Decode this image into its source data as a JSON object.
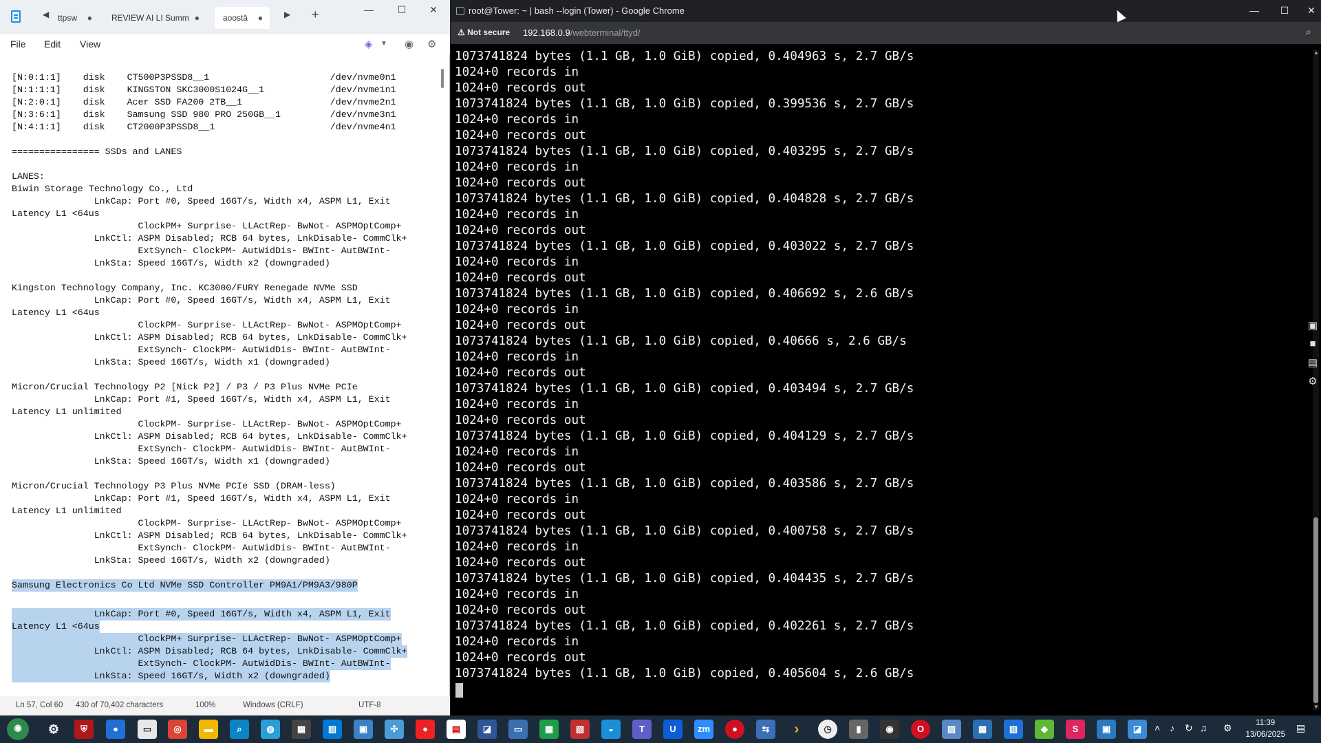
{
  "notepad": {
    "tabs": [
      {
        "label": "ttpsw",
        "active": false
      },
      {
        "label": "REVIEW AI LI",
        "active": false
      },
      {
        "label": "Summ",
        "active": false
      },
      {
        "label": "aoostâ",
        "active": true
      }
    ],
    "menu": [
      "File",
      "Edit",
      "View"
    ],
    "text_lines": [
      "[N:0:1:1]    disk    CT500P3PSSD8__1                      /dev/nvme0n1",
      "[N:1:1:1]    disk    KINGSTON SKC3000S1024G__1            /dev/nvme1n1",
      "[N:2:0:1]    disk    Acer SSD FA200 2TB__1                /dev/nvme2n1",
      "[N:3:6:1]    disk    Samsung SSD 980 PRO 250GB__1         /dev/nvme3n1",
      "[N:4:1:1]    disk    CT2000P3PSSD8__1                     /dev/nvme4n1",
      "",
      "================ SSDs and LANES",
      "",
      "LANES:",
      "Biwin Storage Technology Co., Ltd",
      "               LnkCap: Port #0, Speed 16GT/s, Width x4, ASPM L1, Exit",
      "Latency L1 <64us",
      "                       ClockPM+ Surprise- LLActRep- BwNot- ASPMOptComp+",
      "               LnkCtl: ASPM Disabled; RCB 64 bytes, LnkDisable- CommClk+",
      "                       ExtSynch- ClockPM- AutWidDis- BWInt- AutBWInt-",
      "               LnkSta: Speed 16GT/s, Width x2 (downgraded)",
      "",
      "Kingston Technology Company, Inc. KC3000/FURY Renegade NVMe SSD",
      "               LnkCap: Port #0, Speed 16GT/s, Width x4, ASPM L1, Exit",
      "Latency L1 <64us",
      "                       ClockPM- Surprise- LLActRep- BwNot- ASPMOptComp+",
      "               LnkCtl: ASPM Disabled; RCB 64 bytes, LnkDisable- CommClk+",
      "                       ExtSynch- ClockPM- AutWidDis- BWInt- AutBWInt-",
      "               LnkSta: Speed 16GT/s, Width x1 (downgraded)",
      "",
      "Micron/Crucial Technology P2 [Nick P2] / P3 / P3 Plus NVMe PCIe",
      "               LnkCap: Port #1, Speed 16GT/s, Width x4, ASPM L1, Exit",
      "Latency L1 unlimited",
      "                       ClockPM- Surprise- LLActRep- BwNot- ASPMOptComp+",
      "               LnkCtl: ASPM Disabled; RCB 64 bytes, LnkDisable- CommClk+",
      "                       ExtSynch- ClockPM- AutWidDis- BWInt- AutBWInt-",
      "               LnkSta: Speed 16GT/s, Width x1 (downgraded)",
      "",
      "Micron/Crucial Technology P3 Plus NVMe PCIe SSD (DRAM-less)",
      "               LnkCap: Port #1, Speed 16GT/s, Width x4, ASPM L1, Exit",
      "Latency L1 unlimited",
      "                       ClockPM- Surprise- LLActRep- BwNot- ASPMOptComp+",
      "               LnkCtl: ASPM Disabled; RCB 64 bytes, LnkDisable- CommClk+",
      "                       ExtSynch- ClockPM- AutWidDis- BWInt- AutBWInt-",
      "               LnkSta: Speed 16GT/s, Width x2 (downgraded)",
      "",
      "Samsung Electronics Co Ltd NVMe SSD Controller PM9A1/PM9A3/980P",
      "",
      "               LnkCap: Port #0, Speed 16GT/s, Width x4, ASPM L1, Exit",
      "Latency L1 <64us",
      "                       ClockPM+ Surprise- LLActRep- BwNot- ASPMOptComp+",
      "               LnkCtl: ASPM Disabled; RCB 64 bytes, LnkDisable- CommClk+",
      "                       ExtSynch- ClockPM- AutWidDis- BWInt- AutBWInt-",
      "               LnkSta: Speed 16GT/s, Width x2 (downgraded)"
    ],
    "status": {
      "position": "Ln 57, Col 60",
      "chars": "430 of 70,402 characters",
      "zoom": "100%",
      "line_ending": "Windows (CRLF)",
      "encoding": "UTF-8"
    }
  },
  "chrome": {
    "title": "root@Tower: ~ | bash --login (Tower) - Google Chrome",
    "security": "Not secure",
    "url_host": "192.168.0.9",
    "url_path": "/webterminal/ttyd/",
    "terminal_lines": [
      "1073741824 bytes (1.1 GB, 1.0 GiB) copied, 0.404963 s, 2.7 GB/s",
      "1024+0 records in",
      "1024+0 records out",
      "1073741824 bytes (1.1 GB, 1.0 GiB) copied, 0.399536 s, 2.7 GB/s",
      "1024+0 records in",
      "1024+0 records out",
      "1073741824 bytes (1.1 GB, 1.0 GiB) copied, 0.403295 s, 2.7 GB/s",
      "1024+0 records in",
      "1024+0 records out",
      "1073741824 bytes (1.1 GB, 1.0 GiB) copied, 0.404828 s, 2.7 GB/s",
      "1024+0 records in",
      "1024+0 records out",
      "1073741824 bytes (1.1 GB, 1.0 GiB) copied, 0.403022 s, 2.7 GB/s",
      "1024+0 records in",
      "1024+0 records out",
      "1073741824 bytes (1.1 GB, 1.0 GiB) copied, 0.406692 s, 2.6 GB/s",
      "1024+0 records in",
      "1024+0 records out",
      "1073741824 bytes (1.1 GB, 1.0 GiB) copied, 0.40666 s, 2.6 GB/s",
      "1024+0 records in",
      "1024+0 records out",
      "1073741824 bytes (1.1 GB, 1.0 GiB) copied, 0.403494 s, 2.7 GB/s",
      "1024+0 records in",
      "1024+0 records out",
      "1073741824 bytes (1.1 GB, 1.0 GiB) copied, 0.404129 s, 2.7 GB/s",
      "1024+0 records in",
      "1024+0 records out",
      "1073741824 bytes (1.1 GB, 1.0 GiB) copied, 0.403586 s, 2.7 GB/s",
      "1024+0 records in",
      "1024+0 records out",
      "1073741824 bytes (1.1 GB, 1.0 GiB) copied, 0.400758 s, 2.7 GB/s",
      "1024+0 records in",
      "1024+0 records out",
      "1073741824 bytes (1.1 GB, 1.0 GiB) copied, 0.404435 s, 2.7 GB/s",
      "1024+0 records in",
      "1024+0 records out",
      "1073741824 bytes (1.1 GB, 1.0 GiB) copied, 0.402261 s, 2.7 GB/s",
      "1024+0 records in",
      "1024+0 records out",
      "1073741824 bytes (1.1 GB, 1.0 GiB) copied, 0.405604 s, 2.6 GB/s"
    ]
  },
  "taskbar": {
    "time": "11:39",
    "date": "13/06/2025"
  },
  "colors": {
    "selection": "#b8d3ee",
    "terminal_bg": "#000000",
    "terminal_fg": "#f2f2f2",
    "taskbar_bg": "#1c2b3a"
  }
}
